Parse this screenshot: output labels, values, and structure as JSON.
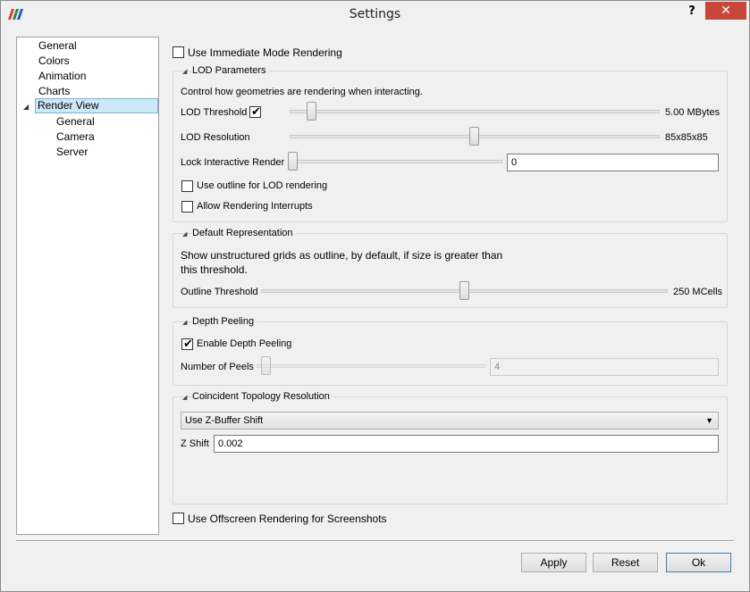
{
  "window": {
    "title": "Settings",
    "help_label": "?",
    "close_label": "✕"
  },
  "tree": {
    "items": [
      {
        "label": "General"
      },
      {
        "label": "Colors"
      },
      {
        "label": "Animation"
      },
      {
        "label": "Charts"
      },
      {
        "label": "Render View"
      },
      {
        "label": "General"
      },
      {
        "label": "Camera"
      },
      {
        "label": "Server"
      }
    ],
    "selected": "Render View"
  },
  "immediate_mode": {
    "label": "Use Immediate Mode Rendering",
    "checked": false
  },
  "lod": {
    "title": "LOD Parameters",
    "description": "Control how geometries are rendering when interacting.",
    "threshold_label": "LOD Threshold",
    "threshold_checked": true,
    "threshold_value": "5.00 MBytes",
    "resolution_label": "LOD Resolution",
    "resolution_value": "85x85x85",
    "lock_label": "Lock Interactive Render",
    "lock_value": "0",
    "outline_label": "Use outline for LOD rendering",
    "outline_checked": false,
    "interrupts_label": "Allow Rendering Interrupts",
    "interrupts_checked": false
  },
  "default_rep": {
    "title": "Default Representation",
    "description_line1": "Show unstructured grids as outline, by default, if size is greater than",
    "description_line2": "this threshold.",
    "outline_label": "Outline Threshold",
    "outline_value": "250 MCells"
  },
  "depth_peeling": {
    "title": "Depth Peeling",
    "enable_label": "Enable Depth Peeling",
    "enable_checked": true,
    "peels_label": "Number of Peels",
    "peels_value": "4"
  },
  "coincident": {
    "title": "Coincident Topology Resolution",
    "mode_selected": "Use Z-Buffer Shift",
    "zshift_label": "Z Shift",
    "zshift_value": "0.002"
  },
  "offscreen": {
    "label": "Use Offscreen Rendering for Screenshots",
    "checked": false
  },
  "buttons": {
    "apply": "Apply",
    "reset": "Reset",
    "ok": "Ok"
  },
  "icons": {
    "check": "✔",
    "triangle": "◢",
    "expanded": "◢",
    "dropdown": "▼"
  }
}
